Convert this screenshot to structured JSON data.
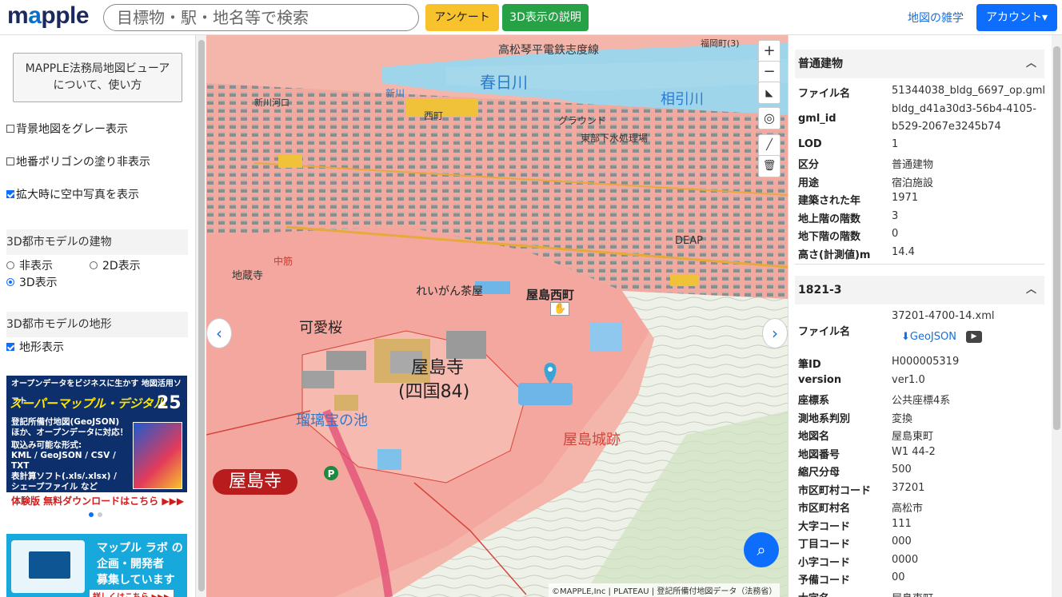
{
  "header": {
    "logo_text_m": "m",
    "logo_text_a": "a",
    "logo_text_rest": "pple",
    "search_placeholder": "目標物・駅・地名等で検索",
    "survey_label": "アンケート",
    "three_d_label": "3D表示の説明",
    "trivia_label": "地図の雑学",
    "account_label": "アカウント▾"
  },
  "left": {
    "about_label_1": "MAPPLE法務局地図ビューア",
    "about_label_2": "について、使い方",
    "opt_gray": "背景地図をグレー表示",
    "opt_polygon": "地番ポリゴンの塗り非表示",
    "opt_aerial": "拡大時に空中写真を表示",
    "sect_building": "3D都市モデルの建物",
    "radio_none": "非表示",
    "radio_2d": "2D表示",
    "radio_3d": "3D表示",
    "sect_terrain": "3D都市モデルの地形",
    "opt_terrain": "地形表示",
    "ad1": {
      "top": "オープンデータをビジネスに生かす 地図活用ソフト",
      "title": "スーパーマップル・デジタル",
      "num": "25",
      "body1": "登記所備付地図(GeoJSON)",
      "body2": "ほか、オープンデータに対応！",
      "body3": "取込み可能な形式:",
      "body4": "KML / GeoJSON / CSV / TXT",
      "body5": "表計算ソフト(.xls/.xlsx) /",
      "body6": "シェープファイル など",
      "foot": "体験版 無料ダウンロードはこちら ▶▶▶"
    },
    "ad2": {
      "line1": "マップル ラボ の",
      "line2": "企画・開発者",
      "line3": "募集しています",
      "more": "詳しくはこちら ▶▶▶"
    }
  },
  "map": {
    "labels": {
      "kasugagawa": "春日川",
      "aibikigawa": "相引川",
      "yashimanishimachi": "屋島西町",
      "yashimaji": "屋島寺",
      "shikoku84": "(四国84)",
      "yashimajoseki": "屋島城跡",
      "yashimaji_big": "屋島寺",
      "kanizakura": "可愛桜",
      "reigan": "れいがん茶屋",
      "ike": "瑠璃宝の池",
      "chikuzo": "地蔵寺",
      "nakasuji": "中筋",
      "kotoden": "高松琴平電鉄志度線",
      "shinkawa": "新川河口",
      "gurando": "グラウンド",
      "gesui": "東部下水処理場",
      "fukuoka": "福岡町(3)",
      "shinkawa2": "新川",
      "nishimachi": "西町",
      "deap": "DEAP"
    },
    "attribution": "©MAPPLE,Inc | PLATEAU | 登記所備付地図データ（法務省）"
  },
  "right": {
    "building": {
      "header": "普通建物",
      "rows": [
        {
          "k": "ファイル名",
          "v": "51344038_bldg_6697_op.gml"
        },
        {
          "k": "gml_id",
          "v": "bldg_d41a30d3-56b4-4105-",
          "v2": "b529-2067e3245b74"
        },
        {
          "k": "LOD",
          "v": "1"
        },
        {
          "k": "区分",
          "v": "普通建物"
        },
        {
          "k": "用途",
          "v": "宿泊施設"
        },
        {
          "k": "建築された年",
          "v": "1971"
        },
        {
          "k": "地上階の階数",
          "v": "3"
        },
        {
          "k": "地下階の階数",
          "v": "0"
        },
        {
          "k": "高さ(計測値)m",
          "v": "14.4"
        }
      ]
    },
    "parcel": {
      "header": "1821-3",
      "file_key": "ファイル名",
      "file_val": "37201-4700-14.xml",
      "geojson": "GeoJSON",
      "rows": [
        {
          "k": "筆ID",
          "v": "H000005319"
        },
        {
          "k": "version",
          "v": "ver1.0"
        },
        {
          "k": "座標系",
          "v": "公共座標4系"
        },
        {
          "k": "測地系判別",
          "v": "変換"
        },
        {
          "k": "地図名",
          "v": "屋島東町"
        },
        {
          "k": "地図番号",
          "v": "W1 44-2"
        },
        {
          "k": "縮尺分母",
          "v": "500"
        },
        {
          "k": "市区町村コード",
          "v": "37201"
        },
        {
          "k": "市区町村名",
          "v": "高松市"
        },
        {
          "k": "大字コード",
          "v": "111"
        },
        {
          "k": "丁目コード",
          "v": "000"
        },
        {
          "k": "小字コード",
          "v": "0000"
        },
        {
          "k": "予備コード",
          "v": "00"
        },
        {
          "k": "大字名",
          "v": "屋島東町"
        }
      ]
    }
  }
}
